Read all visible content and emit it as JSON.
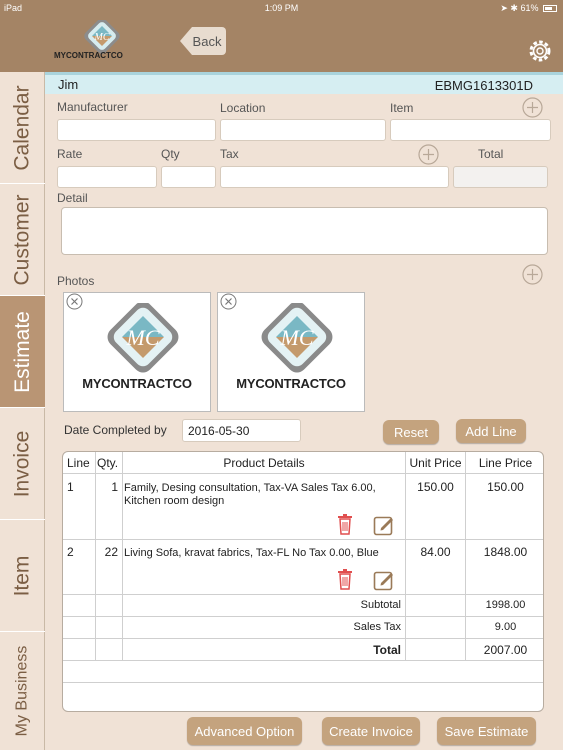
{
  "status": {
    "device": "iPad",
    "time": "1:09 PM",
    "battery": "61%"
  },
  "header": {
    "logo_text": "MYCONTRACTCO",
    "back_label": "Back"
  },
  "sidebar": {
    "tabs": [
      "Calendar",
      "Customer",
      "Estimate",
      "Invoice",
      "Item",
      "My Business"
    ],
    "active": "Estimate"
  },
  "customer": {
    "name": "Jim",
    "code": "EBMG1613301D"
  },
  "form": {
    "manufacturer_label": "Manufacturer",
    "location_label": "Location",
    "item_label": "Item",
    "rate_label": "Rate",
    "qty_label": "Qty",
    "tax_label": "Tax",
    "total_label": "Total",
    "detail_label": "Detail",
    "photos_label": "Photos"
  },
  "photos": [
    {
      "caption": "MYCONTRACTCO"
    },
    {
      "caption": "MYCONTRACTCO"
    }
  ],
  "date": {
    "label": "Date Completed by",
    "value": "2016-05-30"
  },
  "buttons": {
    "reset": "Reset",
    "add_line": "Add Line",
    "advanced": "Advanced Option",
    "create_invoice": "Create Invoice",
    "save_estimate": "Save Estimate"
  },
  "table": {
    "headers": [
      "Line",
      "Qty.",
      "Product Details",
      "Unit Price",
      "Line Price"
    ],
    "rows": [
      {
        "line": "1",
        "qty": "1",
        "details": "Family, Desing consultation, Tax-VA Sales Tax 6.00, Kitchen room design",
        "unit_price": "150.00",
        "line_price": "150.00"
      },
      {
        "line": "2",
        "qty": "22",
        "details": "Living Sofa, kravat fabrics, Tax-FL No Tax 0.00, Blue",
        "unit_price": "84.00",
        "line_price": "1848.00"
      }
    ],
    "subtotal_label": "Subtotal",
    "subtotal": "1998.00",
    "sales_tax_label": "Sales Tax",
    "sales_tax": "9.00",
    "total_label": "Total",
    "total": "2007.00"
  },
  "colors": {
    "brown": "#a48465",
    "tab_active": "#b99574",
    "button": "#c4a37e",
    "teal": "#6fb2bf"
  }
}
